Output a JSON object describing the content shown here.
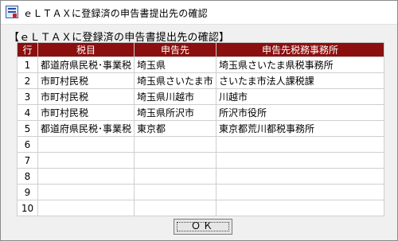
{
  "window": {
    "title": "ｅＬＴＡＸに登録済の申告書提出先の確認",
    "icon": "eltax-app-icon"
  },
  "section_heading": "【ｅＬＴＡＸに登録済の申告書提出先の確認】",
  "table": {
    "header_color": "#8b0f0f",
    "columns": [
      "行",
      "税目",
      "申告先",
      "申告先税務事務所"
    ],
    "rows": [
      [
        "1",
        "都道府県民税･事業税",
        "埼玉県",
        "埼玉県さいたま県税事務所"
      ],
      [
        "2",
        "市町村民税",
        "埼玉県さいたま市",
        "さいたま市法人課税課"
      ],
      [
        "3",
        "市町村民税",
        "埼玉県川越市",
        "川越市"
      ],
      [
        "4",
        "市町村民税",
        "埼玉県所沢市",
        "所沢市役所"
      ],
      [
        "5",
        "都道府県民税･事業税",
        "東京都",
        "東京都荒川都税事務所"
      ],
      [
        "6",
        "",
        "",
        ""
      ],
      [
        "7",
        "",
        "",
        ""
      ],
      [
        "8",
        "",
        "",
        ""
      ],
      [
        "9",
        "",
        "",
        ""
      ],
      [
        "10",
        "",
        "",
        ""
      ]
    ]
  },
  "buttons": {
    "ok_label": "ＯＫ"
  }
}
